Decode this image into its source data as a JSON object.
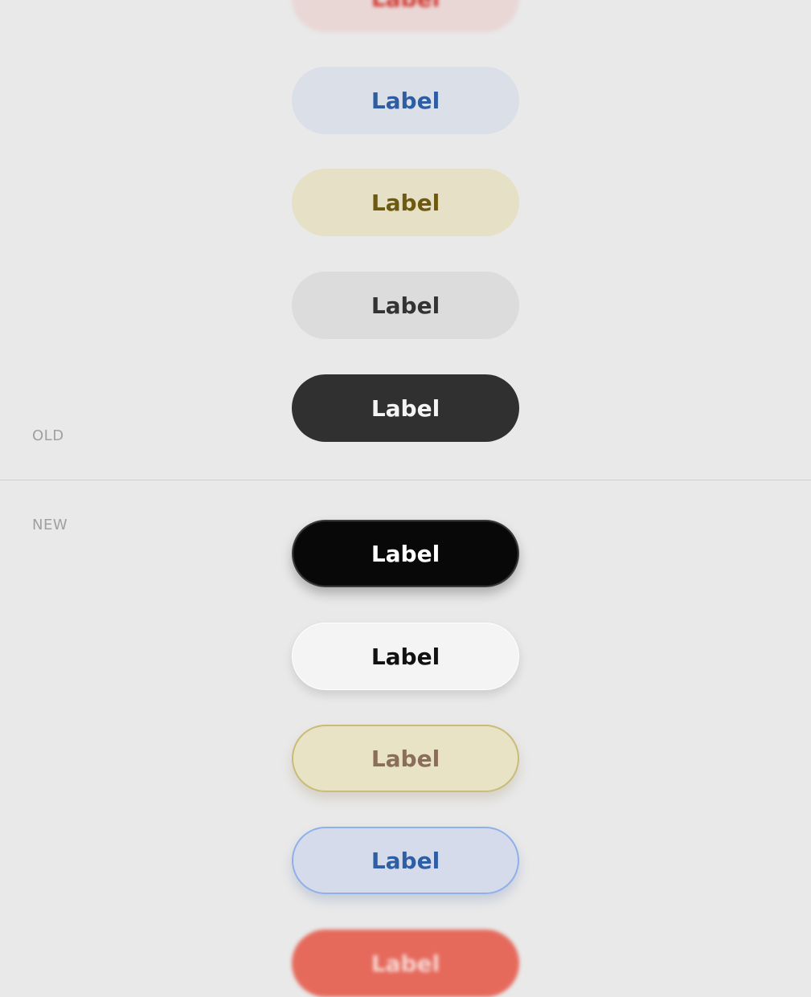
{
  "sections": {
    "old_label": "OLD",
    "new_label": "NEW"
  },
  "old_buttons": [
    {
      "label": "Label",
      "variant": "red-tint",
      "text_color": "#d23a34",
      "bg_color": "#e9d7d6"
    },
    {
      "label": "Label",
      "variant": "blue-tint",
      "text_color": "#2f5da3",
      "bg_color": "#dadfe8"
    },
    {
      "label": "Label",
      "variant": "yellow-tint",
      "text_color": "#6d5a10",
      "bg_color": "#e6e0c6"
    },
    {
      "label": "Label",
      "variant": "gray-tint",
      "text_color": "#333333",
      "bg_color": "#dcdcdc"
    },
    {
      "label": "Label",
      "variant": "dark",
      "text_color": "#f4f4f4",
      "bg_color": "#313030"
    }
  ],
  "new_buttons": [
    {
      "label": "Label",
      "variant": "black",
      "text_color": "#ffffff",
      "bg_color": "#080808"
    },
    {
      "label": "Label",
      "variant": "white",
      "text_color": "#111111",
      "bg_color": "#f4f4f4"
    },
    {
      "label": "Label",
      "variant": "yellow",
      "text_color": "#8a6d5a",
      "bg_color": "#e8e3c5"
    },
    {
      "label": "Label",
      "variant": "blue",
      "text_color": "#2e5fa4",
      "bg_color": "#d6dbeb"
    },
    {
      "label": "Label",
      "variant": "red",
      "text_color": "#f7d7d2",
      "bg_color": "#e56a5c"
    }
  ]
}
